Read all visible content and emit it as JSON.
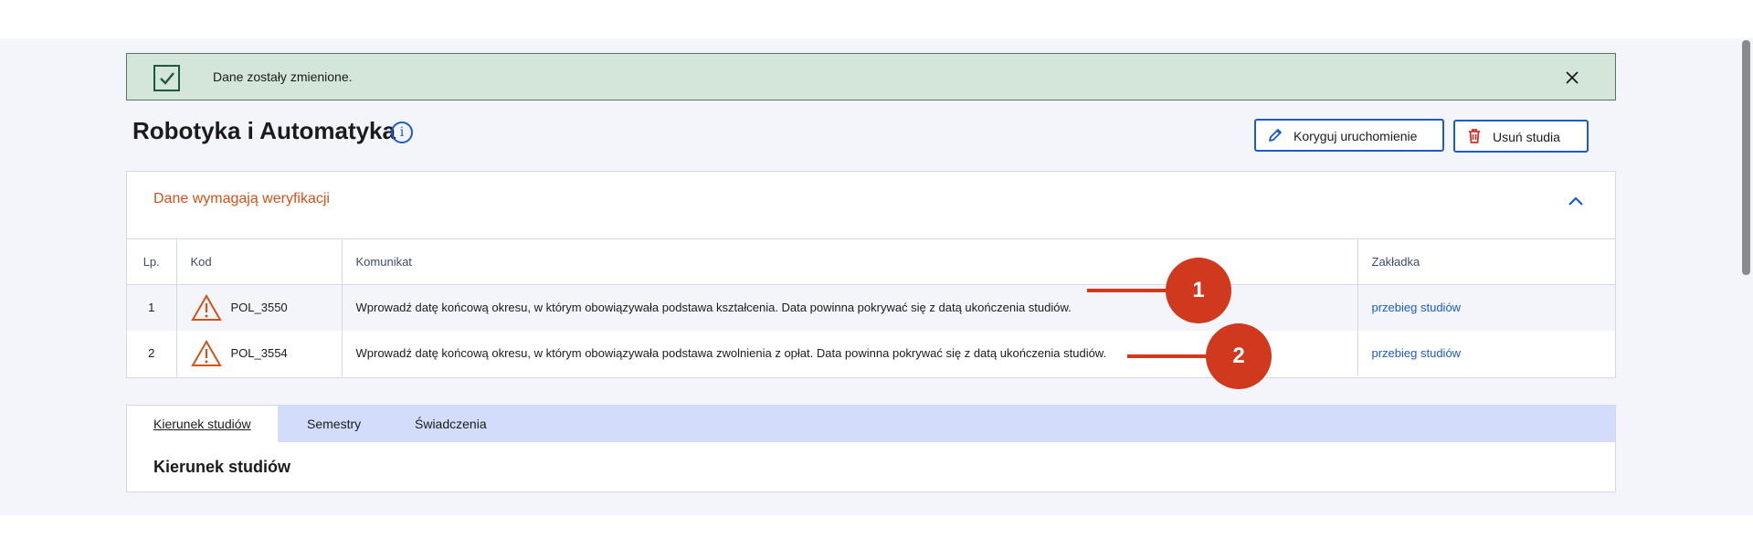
{
  "alert": {
    "message": "Dane zostały zmienione.",
    "icon": "check-icon",
    "close_icon": "close-icon",
    "bg_color": "#d4e5da"
  },
  "header": {
    "title": "Robotyka i Automatyka",
    "info_icon": "i",
    "edit_button": "Koryguj uruchomienie",
    "delete_button": "Usuń studia"
  },
  "verification": {
    "title": "Dane wymagają weryfikacji",
    "title_color": "#d2521a",
    "columns": [
      "Lp.",
      "Kod",
      "Komunikat",
      "Zakładka"
    ],
    "rows": [
      {
        "lp": "1",
        "kod": "POL_3550",
        "komunikat": "Wprowadź datę końcową okresu, w którym obowiązywała podstawa kształcenia. Data powinna pokrywać się z datą ukończenia studiów.",
        "zakladka": "przebieg studiów"
      },
      {
        "lp": "2",
        "kod": "POL_3554",
        "komunikat": "Wprowadź datę końcową okresu, w którym obowiązywała podstawa zwolnienia z opłat. Data powinna pokrywać się z datą ukończenia studiów.",
        "zakladka": "przebieg studiów"
      }
    ]
  },
  "annotations": [
    "1",
    "2"
  ],
  "tabs": {
    "items": [
      "Kierunek studiów",
      "Semestry",
      "Świadczenia"
    ],
    "active": "Kierunek studiów",
    "section_title": "Kierunek studiów"
  }
}
